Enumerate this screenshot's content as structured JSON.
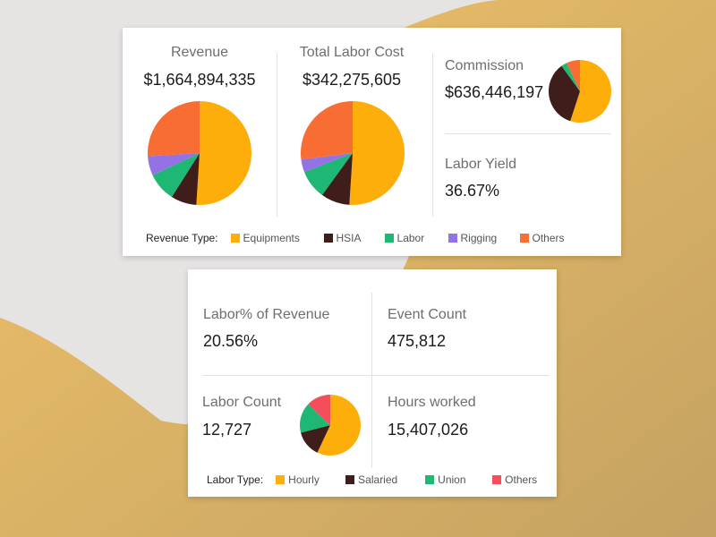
{
  "colors": {
    "equipments": "#fdae0b",
    "hsia": "#3f1d1b",
    "labor": "#1eb774",
    "rigging": "#9372e3",
    "others_revenue": "#f86d33",
    "hourly": "#fdae0b",
    "salaried": "#3f1d1b",
    "union": "#1eb774",
    "others_labor": "#f34e59"
  },
  "top_card": {
    "revenue": {
      "label": "Revenue",
      "value": "$1,664,894,335"
    },
    "total_labor_cost": {
      "label": "Total Labor Cost",
      "value": "$342,275,605"
    },
    "commission": {
      "label": "Commission",
      "value": "$636,446,197"
    },
    "labor_yield": {
      "label": "Labor Yield",
      "value": "36.67%"
    },
    "legend": {
      "title": "Revenue Type:",
      "items": [
        "Equipments",
        "HSIA",
        "Labor",
        "Rigging",
        "Others"
      ]
    }
  },
  "bottom_card": {
    "labor_pct_revenue": {
      "label": "Labor% of Revenue",
      "value": "20.56%"
    },
    "event_count": {
      "label": "Event Count",
      "value": "475,812"
    },
    "labor_count": {
      "label": "Labor Count",
      "value": "12,727"
    },
    "hours_worked": {
      "label": "Hours worked",
      "value": "15,407,026"
    },
    "legend": {
      "title": "Labor Type:",
      "items": [
        "Hourly",
        "Salaried",
        "Union",
        "Others"
      ]
    }
  },
  "chart_data": [
    {
      "type": "pie",
      "categories": [
        "Equipments",
        "HSIA",
        "Labor",
        "Rigging",
        "Others"
      ],
      "values": [
        51,
        8,
        9,
        6,
        26
      ]
    },
    {
      "type": "pie",
      "categories": [
        "Equipments",
        "HSIA",
        "Labor",
        "Rigging",
        "Others"
      ],
      "values": [
        51,
        9,
        9,
        4,
        27
      ]
    },
    {
      "type": "pie",
      "categories": [
        "Equipments",
        "HSIA",
        "Labor",
        "Others"
      ],
      "values": [
        55,
        35,
        3,
        7
      ]
    },
    {
      "type": "pie",
      "categories": [
        "Hourly",
        "Salaried",
        "Union",
        "Others"
      ],
      "values": [
        57,
        14,
        16,
        13
      ]
    }
  ]
}
